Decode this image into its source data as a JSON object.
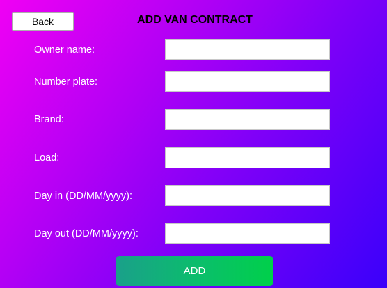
{
  "header": {
    "back_label": "Back",
    "title": "ADD VAN CONTRACT"
  },
  "form": {
    "owner_name_label": "Owner name:",
    "owner_name_value": "",
    "number_plate_label": "Number plate:",
    "number_plate_value": "",
    "brand_label": "Brand:",
    "brand_value": "",
    "load_label": "Load:",
    "load_value": "",
    "day_in_label": "Day in (DD/MM/yyyy):",
    "day_in_value": "",
    "day_out_label": "Day out (DD/MM/yyyy):",
    "day_out_value": ""
  },
  "actions": {
    "add_label": "ADD"
  },
  "colors": {
    "gradient_start": "#f000f4",
    "gradient_end": "#3a00fa",
    "add_button_green": "#00c850"
  }
}
